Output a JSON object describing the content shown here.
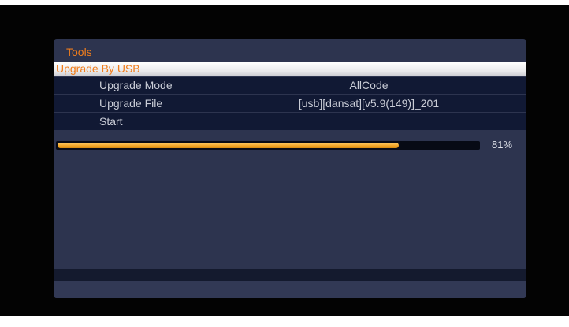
{
  "menu": {
    "title": "Tools",
    "selected_header": "Upgrade By USB"
  },
  "settings": [
    {
      "label": "Upgrade Mode",
      "value": "AllCode"
    },
    {
      "label": "Upgrade File",
      "value": "[usb][dansat][v5.9(149)]_201"
    },
    {
      "label": "Start",
      "value": ""
    }
  ],
  "progress": {
    "percent_value": 81,
    "percent_text": "81%"
  },
  "colors": {
    "accent": "#f07d1c",
    "panel": "#2d344f",
    "row": "#111934",
    "progress_fill": "#f2a526"
  }
}
